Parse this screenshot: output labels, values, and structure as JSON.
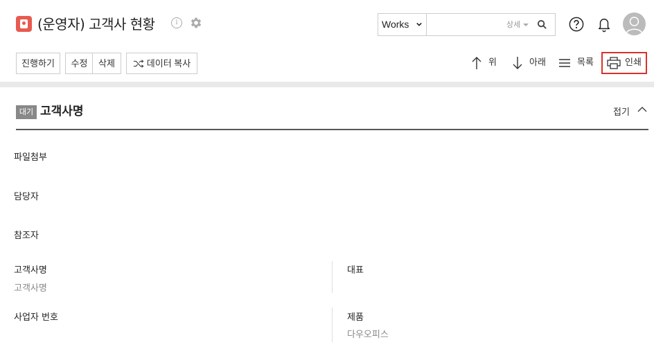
{
  "header": {
    "title": "(운영자) 고객사 현황",
    "info_glyph": "i"
  },
  "search": {
    "scope_selected": "Works",
    "input_value": "",
    "detail_label": "상세"
  },
  "toolbar": {
    "progress_label": "진행하기",
    "edit_label": "수정",
    "delete_label": "삭제",
    "copy_label": "데이터 복사",
    "up_label": "위",
    "down_label": "아래",
    "list_label": "목록",
    "print_label": "인쇄"
  },
  "section": {
    "status_badge": "대기",
    "title": "고객사명",
    "fold_label": "접기"
  },
  "fields": {
    "attachment": {
      "label": "파일첨부"
    },
    "assignee": {
      "label": "담당자"
    },
    "cc": {
      "label": "참조자"
    },
    "customer_name": {
      "label": "고객사명",
      "value": "고객사명"
    },
    "representative": {
      "label": "대표",
      "value": ""
    },
    "business_number": {
      "label": "사업자 번호",
      "value": ""
    },
    "product": {
      "label": "제품",
      "value": "다우오피스"
    }
  },
  "colors": {
    "accent_red": "#d9312b",
    "app_icon": "#e85a4f",
    "badge_gray": "#888888"
  }
}
